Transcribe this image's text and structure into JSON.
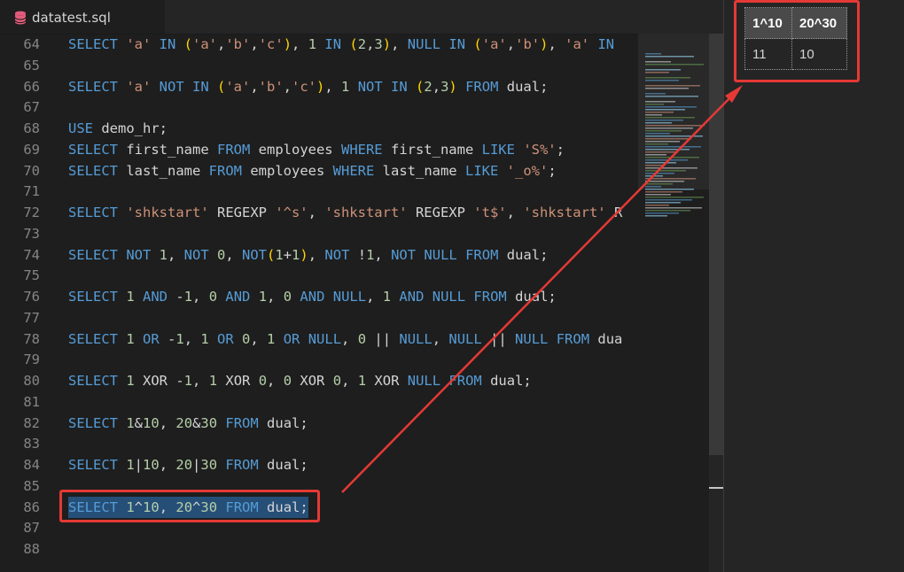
{
  "tab": {
    "label": "datatest.sql",
    "icon": "database-icon"
  },
  "editor": {
    "lines": [
      {
        "num": "64",
        "tokens": [
          [
            "k",
            "SELECT "
          ],
          [
            "s",
            "'a'"
          ],
          [
            "k",
            " IN "
          ],
          [
            "p",
            "("
          ],
          [
            "s",
            "'a'"
          ],
          [
            "d",
            ","
          ],
          [
            "s",
            "'b'"
          ],
          [
            "d",
            ","
          ],
          [
            "s",
            "'c'"
          ],
          [
            "p",
            ")"
          ],
          [
            "d",
            ", "
          ],
          [
            "n",
            "1"
          ],
          [
            "k",
            " IN "
          ],
          [
            "p",
            "("
          ],
          [
            "n",
            "2"
          ],
          [
            "d",
            ","
          ],
          [
            "n",
            "3"
          ],
          [
            "p",
            ")"
          ],
          [
            "d",
            ", "
          ],
          [
            "k",
            "NULL"
          ],
          [
            "k",
            " IN "
          ],
          [
            "p",
            "("
          ],
          [
            "s",
            "'a'"
          ],
          [
            "d",
            ","
          ],
          [
            "s",
            "'b'"
          ],
          [
            "p",
            ")"
          ],
          [
            "d",
            ", "
          ],
          [
            "s",
            "'a'"
          ],
          [
            "k",
            " IN"
          ]
        ]
      },
      {
        "num": "65",
        "tokens": []
      },
      {
        "num": "66",
        "tokens": [
          [
            "k",
            "SELECT "
          ],
          [
            "s",
            "'a'"
          ],
          [
            "k",
            " NOT IN "
          ],
          [
            "p",
            "("
          ],
          [
            "s",
            "'a'"
          ],
          [
            "d",
            ","
          ],
          [
            "s",
            "'b'"
          ],
          [
            "d",
            ","
          ],
          [
            "s",
            "'c'"
          ],
          [
            "p",
            ")"
          ],
          [
            "d",
            ", "
          ],
          [
            "n",
            "1"
          ],
          [
            "k",
            " NOT IN "
          ],
          [
            "p",
            "("
          ],
          [
            "n",
            "2"
          ],
          [
            "d",
            ","
          ],
          [
            "n",
            "3"
          ],
          [
            "p",
            ")"
          ],
          [
            "k",
            " FROM "
          ],
          [
            "d",
            "dual;"
          ]
        ]
      },
      {
        "num": "67",
        "tokens": []
      },
      {
        "num": "68",
        "tokens": [
          [
            "k",
            "USE "
          ],
          [
            "d",
            "demo_hr;"
          ]
        ]
      },
      {
        "num": "69",
        "tokens": [
          [
            "k",
            "SELECT "
          ],
          [
            "d",
            "first_name "
          ],
          [
            "k",
            "FROM "
          ],
          [
            "d",
            "employees "
          ],
          [
            "k",
            "WHERE "
          ],
          [
            "d",
            "first_name "
          ],
          [
            "k",
            "LIKE "
          ],
          [
            "s",
            "'S%'"
          ],
          [
            "d",
            ";"
          ]
        ]
      },
      {
        "num": "70",
        "tokens": [
          [
            "k",
            "SELECT "
          ],
          [
            "d",
            "last_name "
          ],
          [
            "k",
            "FROM "
          ],
          [
            "d",
            "employees "
          ],
          [
            "k",
            "WHERE "
          ],
          [
            "d",
            "last_name "
          ],
          [
            "k",
            "LIKE "
          ],
          [
            "s",
            "'_o%'"
          ],
          [
            "d",
            ";"
          ]
        ]
      },
      {
        "num": "71",
        "tokens": []
      },
      {
        "num": "72",
        "tokens": [
          [
            "k",
            "SELECT "
          ],
          [
            "s",
            "'shkstart'"
          ],
          [
            "d",
            " REGEXP "
          ],
          [
            "s",
            "'^s'"
          ],
          [
            "d",
            ", "
          ],
          [
            "s",
            "'shkstart'"
          ],
          [
            "d",
            " REGEXP "
          ],
          [
            "s",
            "'t$'"
          ],
          [
            "d",
            ", "
          ],
          [
            "s",
            "'shkstart'"
          ],
          [
            "d",
            " R"
          ]
        ]
      },
      {
        "num": "73",
        "tokens": []
      },
      {
        "num": "74",
        "tokens": [
          [
            "k",
            "SELECT NOT "
          ],
          [
            "n",
            "1"
          ],
          [
            "d",
            ", "
          ],
          [
            "k",
            "NOT "
          ],
          [
            "n",
            "0"
          ],
          [
            "d",
            ", "
          ],
          [
            "k",
            "NOT"
          ],
          [
            "p",
            "("
          ],
          [
            "n",
            "1"
          ],
          [
            "d",
            "+"
          ],
          [
            "n",
            "1"
          ],
          [
            "p",
            ")"
          ],
          [
            "d",
            ", "
          ],
          [
            "k",
            "NOT "
          ],
          [
            "d",
            "!"
          ],
          [
            "n",
            "1"
          ],
          [
            "d",
            ", "
          ],
          [
            "k",
            "NOT NULL FROM "
          ],
          [
            "d",
            "dual;"
          ]
        ]
      },
      {
        "num": "75",
        "tokens": []
      },
      {
        "num": "76",
        "tokens": [
          [
            "k",
            "SELECT "
          ],
          [
            "n",
            "1"
          ],
          [
            "k",
            " AND "
          ],
          [
            "d",
            "-"
          ],
          [
            "n",
            "1"
          ],
          [
            "d",
            ", "
          ],
          [
            "n",
            "0"
          ],
          [
            "k",
            " AND "
          ],
          [
            "n",
            "1"
          ],
          [
            "d",
            ", "
          ],
          [
            "n",
            "0"
          ],
          [
            "k",
            " AND NULL"
          ],
          [
            "d",
            ", "
          ],
          [
            "n",
            "1"
          ],
          [
            "k",
            " AND NULL FROM "
          ],
          [
            "d",
            "dual;"
          ]
        ]
      },
      {
        "num": "77",
        "tokens": []
      },
      {
        "num": "78",
        "tokens": [
          [
            "k",
            "SELECT "
          ],
          [
            "n",
            "1"
          ],
          [
            "k",
            " OR "
          ],
          [
            "d",
            "-"
          ],
          [
            "n",
            "1"
          ],
          [
            "d",
            ", "
          ],
          [
            "n",
            "1"
          ],
          [
            "k",
            " OR "
          ],
          [
            "n",
            "0"
          ],
          [
            "d",
            ", "
          ],
          [
            "n",
            "1"
          ],
          [
            "k",
            " OR NULL"
          ],
          [
            "d",
            ", "
          ],
          [
            "n",
            "0"
          ],
          [
            "d",
            " || "
          ],
          [
            "k",
            "NULL"
          ],
          [
            "d",
            ", "
          ],
          [
            "k",
            "NULL"
          ],
          [
            "d",
            " || "
          ],
          [
            "k",
            "NULL FROM "
          ],
          [
            "d",
            "dua"
          ]
        ]
      },
      {
        "num": "79",
        "tokens": []
      },
      {
        "num": "80",
        "tokens": [
          [
            "k",
            "SELECT "
          ],
          [
            "n",
            "1"
          ],
          [
            "d",
            " XOR -"
          ],
          [
            "n",
            "1"
          ],
          [
            "d",
            ", "
          ],
          [
            "n",
            "1"
          ],
          [
            "d",
            " XOR "
          ],
          [
            "n",
            "0"
          ],
          [
            "d",
            ", "
          ],
          [
            "n",
            "0"
          ],
          [
            "d",
            " XOR "
          ],
          [
            "n",
            "0"
          ],
          [
            "d",
            ", "
          ],
          [
            "n",
            "1"
          ],
          [
            "d",
            " XOR "
          ],
          [
            "k",
            "NULL FROM "
          ],
          [
            "d",
            "dual;"
          ]
        ]
      },
      {
        "num": "81",
        "tokens": []
      },
      {
        "num": "82",
        "tokens": [
          [
            "k",
            "SELECT "
          ],
          [
            "n",
            "1"
          ],
          [
            "d",
            "&"
          ],
          [
            "n",
            "10"
          ],
          [
            "d",
            ", "
          ],
          [
            "n",
            "20"
          ],
          [
            "d",
            "&"
          ],
          [
            "n",
            "30"
          ],
          [
            "k",
            " FROM "
          ],
          [
            "d",
            "dual;"
          ]
        ]
      },
      {
        "num": "83",
        "tokens": []
      },
      {
        "num": "84",
        "tokens": [
          [
            "k",
            "SELECT "
          ],
          [
            "n",
            "1"
          ],
          [
            "d",
            "|"
          ],
          [
            "n",
            "10"
          ],
          [
            "d",
            ", "
          ],
          [
            "n",
            "20"
          ],
          [
            "d",
            "|"
          ],
          [
            "n",
            "30"
          ],
          [
            "k",
            " FROM "
          ],
          [
            "d",
            "dual;"
          ]
        ]
      },
      {
        "num": "85",
        "tokens": []
      },
      {
        "num": "86",
        "selected": true,
        "tokens": [
          [
            "k",
            "SELECT "
          ],
          [
            "n",
            "1"
          ],
          [
            "d",
            "^"
          ],
          [
            "n",
            "10"
          ],
          [
            "d",
            ", "
          ],
          [
            "n",
            "20"
          ],
          [
            "d",
            "^"
          ],
          [
            "n",
            "30"
          ],
          [
            "k",
            " FROM "
          ],
          [
            "d",
            "dual;"
          ]
        ]
      },
      {
        "num": "87",
        "tokens": []
      },
      {
        "num": "88",
        "tokens": []
      }
    ]
  },
  "result": {
    "columns": [
      "1^10",
      "20^30"
    ],
    "rows": [
      [
        "11",
        "10"
      ]
    ]
  },
  "colors": {
    "keyword": "#569cd6",
    "string": "#ce9178",
    "number": "#b5cea8",
    "annotation": "#e53935"
  }
}
